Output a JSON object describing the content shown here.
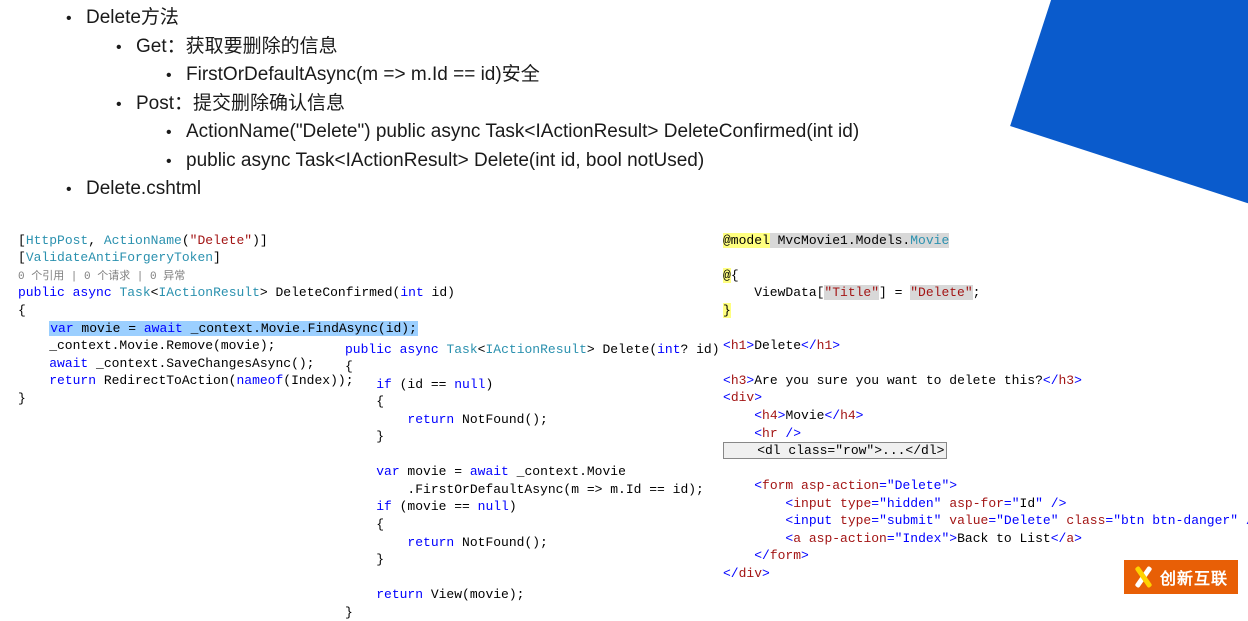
{
  "bullets": {
    "l1a": "Delete方法",
    "l2a": "Get：获取要删除的信息",
    "l3a": "FirstOrDefaultAsync(m => m.Id == id)安全",
    "l2b": "Post：提交删除确认信息",
    "l3b": "ActionName(\"Delete\") public async Task<IActionResult> DeleteConfirmed(int id)",
    "l3c": "public async Task<IActionResult> Delete(int id, bool notUsed)",
    "l1b": "Delete.cshtml"
  },
  "code1": {
    "p1a": "[",
    "p1b": "HttpPost",
    "p1c": ", ",
    "p1d": "ActionName",
    "p1e": "(",
    "p1f": "\"Delete\"",
    "p1g": ")]",
    "p2a": "[",
    "p2b": "ValidateAntiForgeryToken",
    "p2c": "]",
    "p3": "0 个引用 | 0 个请求 | 0 异常",
    "p4a": "public",
    "p4b": " ",
    "p4c": "async",
    "p4d": " ",
    "p4e": "Task",
    "p4f": "<",
    "p4g": "IActionResult",
    "p4h": "> DeleteConfirmed(",
    "p4i": "int",
    "p4j": " id)",
    "p5": "{",
    "p6a": "    ",
    "p6b": "var",
    "p6c": " movie = ",
    "p6d": "await",
    "p6e": " _context.Movie.FindAsync(id);",
    "p7": "    _context.Movie.Remove(movie);",
    "p8a": "    ",
    "p8b": "await",
    "p8c": " _context.SaveChangesAsync();",
    "p9a": "    ",
    "p9b": "return",
    "p9c": " RedirectToAction(",
    "p9d": "nameof",
    "p9e": "(Index));",
    "p10": "}"
  },
  "code2": {
    "p1a": "public",
    "p1b": " ",
    "p1c": "async",
    "p1d": " ",
    "p1e": "Task",
    "p1f": "<",
    "p1g": "IActionResult",
    "p1h": "> Delete(",
    "p1i": "int",
    "p1j": "? id)",
    "p2": "{",
    "p3a": "    ",
    "p3b": "if",
    "p3c": " (id == ",
    "p3d": "null",
    "p3e": ")",
    "p4": "    {",
    "p5a": "        ",
    "p5b": "return",
    "p5c": " NotFound();",
    "p6": "    }",
    "blank1": "",
    "p7a": "    ",
    "p7b": "var",
    "p7c": " movie = ",
    "p7d": "await",
    "p7e": " _context.Movie",
    "p8": "        .FirstOrDefaultAsync(m => m.Id == id);",
    "p9a": "    ",
    "p9b": "if",
    "p9c": " (movie == ",
    "p9d": "null",
    "p9e": ")",
    "p10": "    {",
    "p11a": "        ",
    "p11b": "return",
    "p11c": " NotFound();",
    "p12": "    }",
    "blank2": "",
    "p13a": "    ",
    "p13b": "return",
    "p13c": " View(movie);",
    "p14": "}"
  },
  "code3": {
    "p1a": "@model",
    "p1b": " MvcMovie1.Models.",
    "p1c": "Movie",
    "blank1": "",
    "p2a": "@",
    "p2b": "{",
    "p3a": "    ViewData[",
    "p3b": "\"Title\"",
    "p3c": "] = ",
    "p3d": "\"Delete\"",
    "p3e": ";",
    "p4": "}",
    "blank2": "",
    "p5a": "<",
    "p5b": "h1",
    "p5c": ">",
    "p5d": "Delete",
    "p5e": "</",
    "p5f": "h1",
    "p5g": ">",
    "blank3": "",
    "p6a": "<",
    "p6b": "h3",
    "p6c": ">",
    "p6d": "Are you sure you want to delete this?",
    "p6e": "</",
    "p6f": "h3",
    "p6g": ">",
    "p7a": "<",
    "p7b": "div",
    "p7c": ">",
    "p8a": "    <",
    "p8b": "h4",
    "p8c": ">",
    "p8d": "Movie",
    "p8e": "</",
    "p8f": "h4",
    "p8g": ">",
    "p9a": "    <",
    "p9b": "hr",
    "p9c": " />",
    "p10": "    <dl class=\"row\">...</dl>",
    "blank4": "",
    "p11a": "    <",
    "p11b": "form",
    "p11c": " ",
    "p11d": "asp-action",
    "p11e": "=",
    "p11f": "\"Delete\"",
    "p11g": ">",
    "p12a": "        <",
    "p12b": "input",
    "p12c": " ",
    "p12d": "type",
    "p12e": "=",
    "p12f": "\"hidden\"",
    "p12g": " ",
    "p12h": "asp-for",
    "p12i": "=",
    "p12j": "\"",
    "p12k": "Id",
    "p12l": "\"",
    "p12m": " />",
    "p13a": "        <",
    "p13b": "input ",
    "p13c": "type",
    "p13d": "=",
    "p13e": "\"submit\"",
    "p13f": " ",
    "p13g": "value",
    "p13h": "=",
    "p13i": "\"Delete\"",
    "p13j": " ",
    "p13k": "class",
    "p13l": "=",
    "p13m": "\"btn btn-danger\"",
    "p13n": " />",
    "p14a": "        <",
    "p14b": "a",
    "p14c": " ",
    "p14d": "asp-action",
    "p14e": "=",
    "p14f": "\"Index\"",
    "p14g": ">",
    "p14h": "Back to List",
    "p14i": "</",
    "p14j": "a",
    "p14k": ">",
    "p15a": "    </",
    "p15b": "form",
    "p15c": ">",
    "p16a": "</",
    "p16b": "div",
    "p16c": ">"
  },
  "logo": {
    "text": "创新互联"
  }
}
